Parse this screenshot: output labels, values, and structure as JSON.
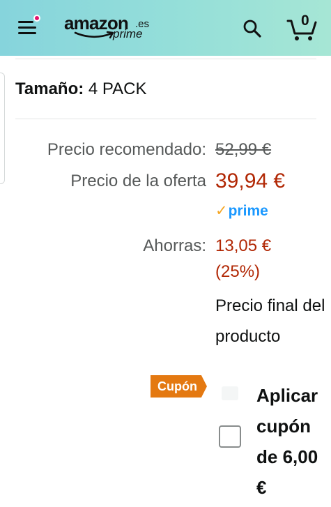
{
  "header": {
    "logo_word": "amazon",
    "logo_tld": ".es",
    "logo_prime": "prime",
    "cart_count": "0",
    "menu_has_notification": true,
    "colors": {
      "notification_dot": "#e3116c",
      "gradient_start": "#86d4dc",
      "gradient_end": "#a6e6d5"
    }
  },
  "product": {
    "size_label": "Tamaño:",
    "size_value": "4 PACK"
  },
  "pricing": {
    "list_price_label": "Precio recomendado:",
    "list_price": "52,99 €",
    "deal_price_label": "Precio de la oferta",
    "deal_price": "39,94 €",
    "prime_label": "prime",
    "savings_label": "Ahorras:",
    "savings_amount": "13,05 €",
    "savings_percent": "(25%)",
    "final_price_note": "Precio final del producto",
    "colors": {
      "price": "#b12704",
      "prime": "#1a98ff",
      "prime_check": "#f5a623"
    }
  },
  "coupon": {
    "tag_label": "Cupón",
    "apply_text": "Aplicar cupón de 6,00 €",
    "checked": false,
    "colors": {
      "tag": "#e47911"
    }
  }
}
